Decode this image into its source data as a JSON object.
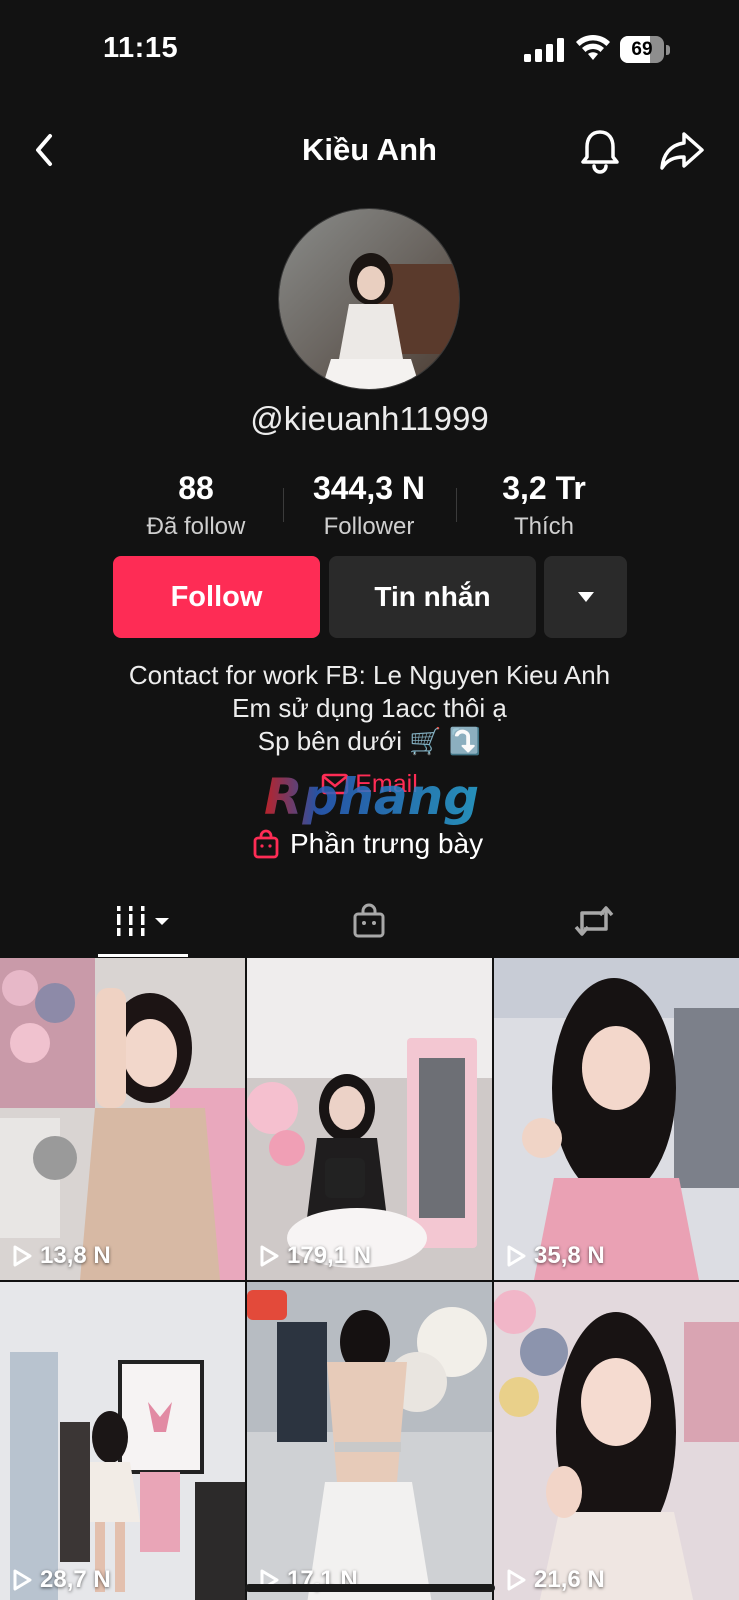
{
  "status": {
    "time": "11:15",
    "battery": "69",
    "battery_level": 0.69
  },
  "header": {
    "title": "Kiều Anh"
  },
  "profile": {
    "username": "@kieuanh11999",
    "stats": [
      {
        "value": "88",
        "label": "Đã follow"
      },
      {
        "value": "344,3 N",
        "label": "Follower"
      },
      {
        "value": "3,2 Tr",
        "label": "Thích"
      }
    ],
    "follow_label": "Follow",
    "message_label": "Tin nhắn",
    "bio": [
      "Contact for work FB: Le Nguyen Kieu Anh",
      "Em sử dụng 1acc thôi ạ",
      "Sp bên dưới 🛒 ⤵️"
    ],
    "email_label": "Email",
    "showcase_label": "Phần trưng bày",
    "watermark": "Rphang"
  },
  "tabs": [
    {
      "icon": "grid-icon",
      "active": true
    },
    {
      "icon": "shop-bag-icon",
      "active": false
    },
    {
      "icon": "repost-icon",
      "active": false
    }
  ],
  "videos": [
    {
      "views": "13,8 N"
    },
    {
      "views": "179,1 N"
    },
    {
      "views": "35,8 N"
    },
    {
      "views": "28,7 N"
    },
    {
      "views": "17,1 N"
    },
    {
      "views": "21,6 N"
    }
  ],
  "colors": {
    "accent": "#fe2c55",
    "background": "#121212",
    "button_secondary": "#2a2a2a"
  }
}
